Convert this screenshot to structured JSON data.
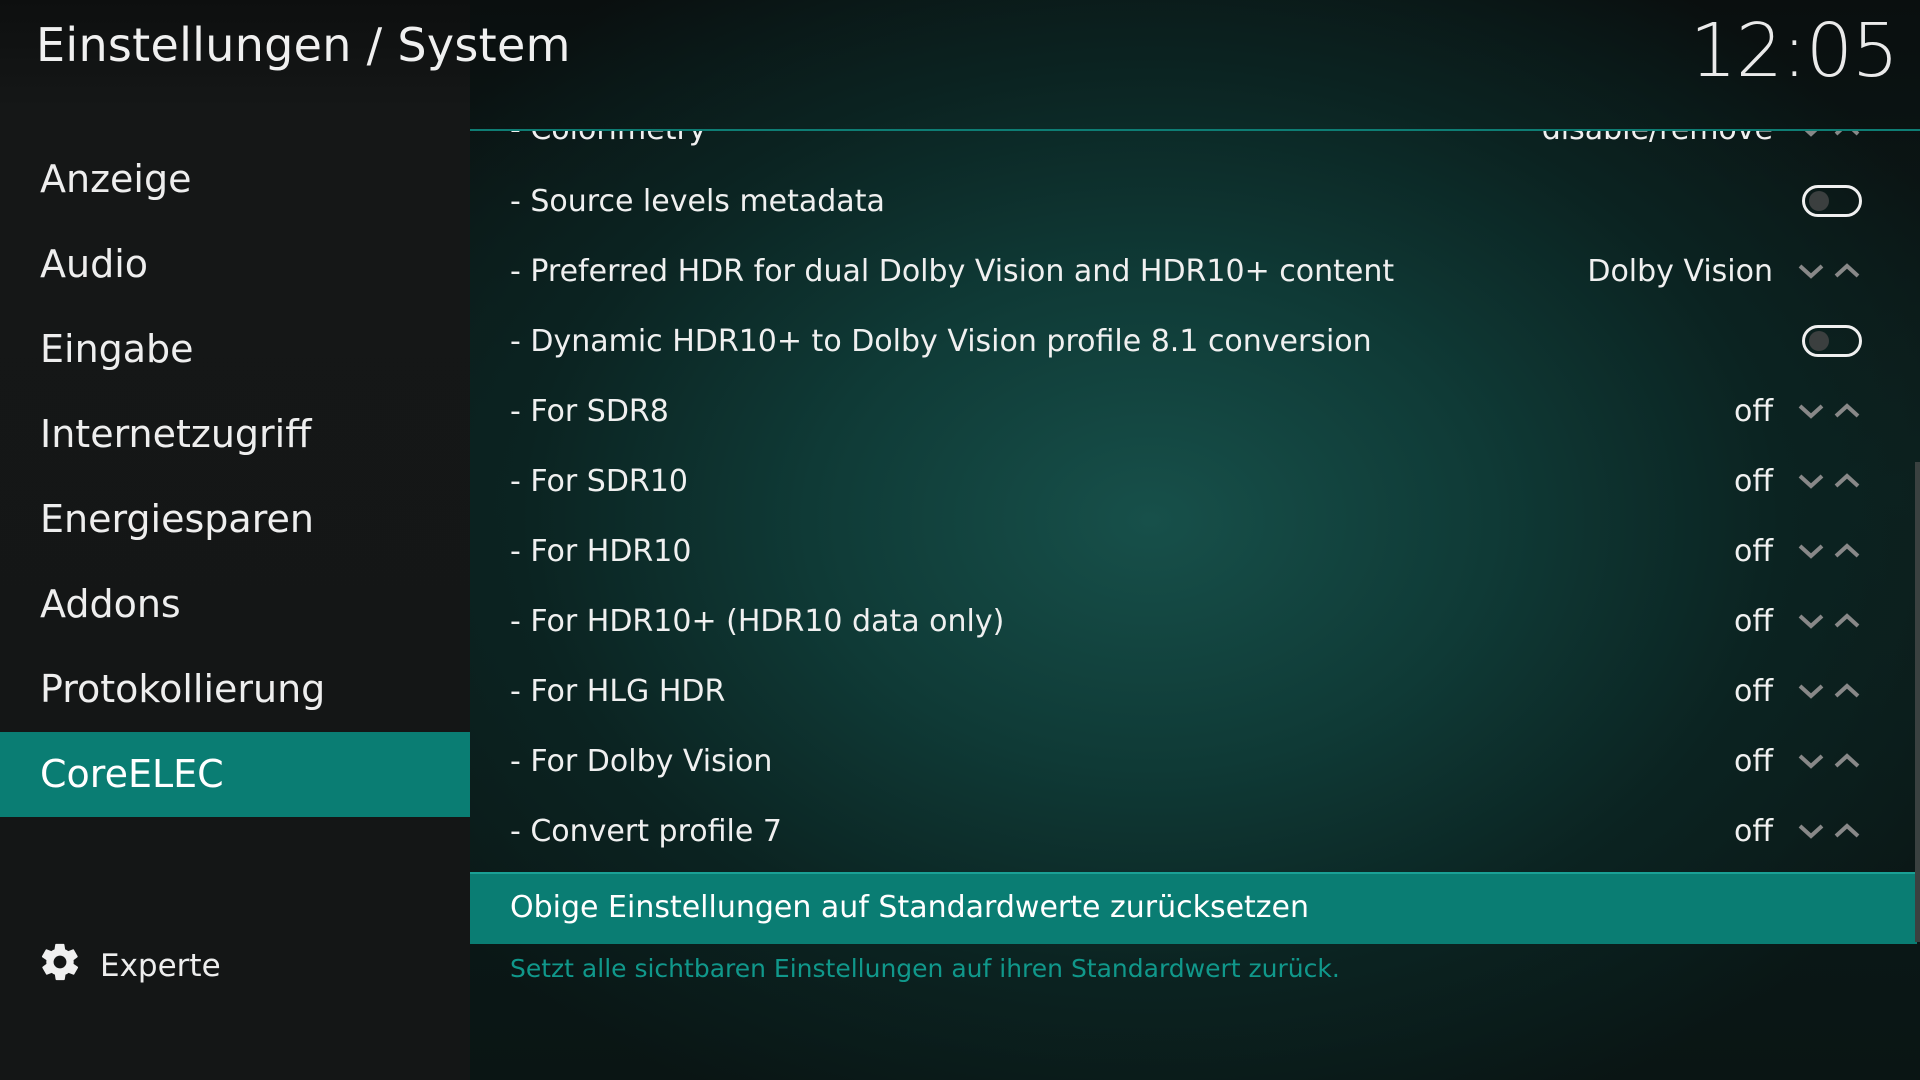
{
  "header": {
    "title": "Einstellungen / System",
    "clock": "12:05"
  },
  "sidebar": {
    "items": [
      {
        "label": "Anzeige"
      },
      {
        "label": "Audio"
      },
      {
        "label": "Eingabe"
      },
      {
        "label": "Internetzugriff"
      },
      {
        "label": "Energiesparen"
      },
      {
        "label": "Addons"
      },
      {
        "label": "Protokollierung"
      },
      {
        "label": "CoreELEC"
      }
    ],
    "active_item": "CoreELEC",
    "level": {
      "icon": "gear-icon",
      "label": "Experte"
    }
  },
  "settings": {
    "rows": [
      {
        "label": "- Colorimetry",
        "value": "disable/remove",
        "control": "spinner"
      },
      {
        "label": "- Source levels metadata",
        "value": "",
        "control": "toggle",
        "checked": false
      },
      {
        "label": "- Preferred HDR for dual Dolby Vision and HDR10+ content",
        "value": "Dolby Vision",
        "control": "spinner"
      },
      {
        "label": "- Dynamic HDR10+ to Dolby Vision profile 8.1 conversion",
        "value": "",
        "control": "toggle",
        "checked": false
      },
      {
        "label": "- For SDR8",
        "value": "off",
        "control": "spinner"
      },
      {
        "label": "- For SDR10",
        "value": "off",
        "control": "spinner"
      },
      {
        "label": "- For HDR10",
        "value": "off",
        "control": "spinner"
      },
      {
        "label": "- For HDR10+ (HDR10 data only)",
        "value": "off",
        "control": "spinner"
      },
      {
        "label": "- For HLG HDR",
        "value": "off",
        "control": "spinner"
      },
      {
        "label": "- For Dolby Vision",
        "value": "off",
        "control": "spinner"
      },
      {
        "label": "- Convert profile 7",
        "value": "off",
        "control": "spinner"
      }
    ],
    "reset_label": "Obige Einstellungen auf Standardwerte zurücksetzen",
    "reset_hint": "Setzt alle sichtbaren Einstellungen auf ihren Standardwert zurück."
  },
  "colors": {
    "accent": "#0a7d73",
    "hint_text": "#10988b"
  }
}
